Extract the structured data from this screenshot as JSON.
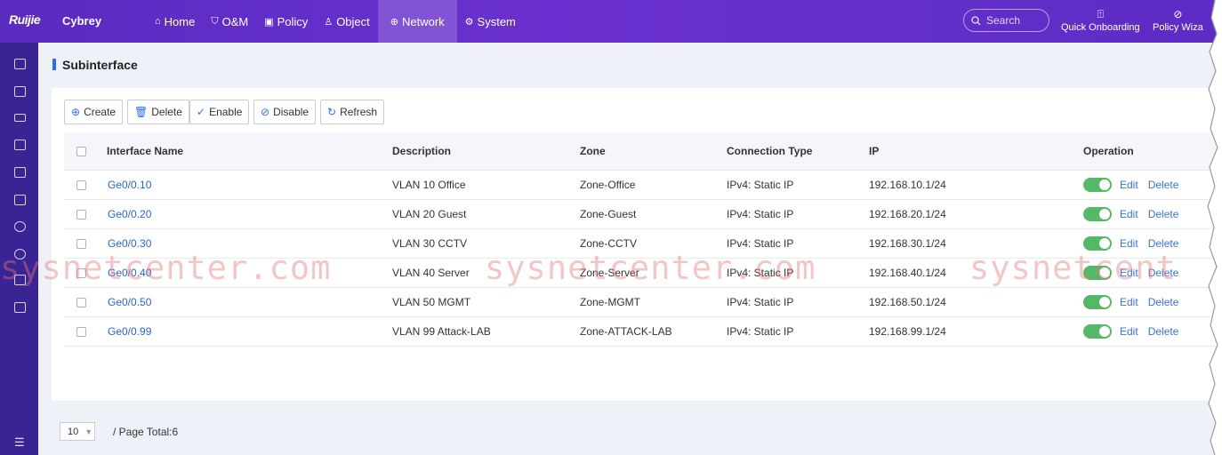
{
  "brand": {
    "logo": "Ruijie",
    "product": "Cybrey"
  },
  "nav": [
    {
      "label": "Home",
      "icon": "home-icon",
      "glyph": "⌂",
      "active": false
    },
    {
      "label": "O&M",
      "icon": "shield-icon",
      "glyph": "⛉",
      "active": false
    },
    {
      "label": "Policy",
      "icon": "policy-icon",
      "glyph": "▣",
      "active": false
    },
    {
      "label": "Object",
      "icon": "user-icon",
      "glyph": "♙",
      "active": false
    },
    {
      "label": "Network",
      "icon": "globe-icon",
      "glyph": "⊕",
      "active": true
    },
    {
      "label": "System",
      "icon": "gear-icon",
      "glyph": "⚙",
      "active": false
    }
  ],
  "search": {
    "placeholder": "Search"
  },
  "tools": {
    "quick_onboarding": "Quick Onboarding",
    "policy_wizard": "Policy Wiza"
  },
  "page": {
    "title": "Subinterface"
  },
  "toolbar": {
    "create": "Create",
    "delete": "Delete",
    "enable": "Enable",
    "disable": "Disable",
    "refresh": "Refresh"
  },
  "table": {
    "columns": {
      "name": "Interface Name",
      "description": "Description",
      "zone": "Zone",
      "connection_type": "Connection Type",
      "ip": "IP",
      "operation": "Operation"
    },
    "rows": [
      {
        "name": "Ge0/0.10",
        "description": "VLAN 10 Office",
        "zone": "Zone-Office",
        "connection_type": "IPv4: Static IP",
        "ip": "192.168.10.1/24",
        "enabled": true,
        "edit": "Edit",
        "delete": "Delete"
      },
      {
        "name": "Ge0/0.20",
        "description": "VLAN 20 Guest",
        "zone": "Zone-Guest",
        "connection_type": "IPv4: Static IP",
        "ip": "192.168.20.1/24",
        "enabled": true,
        "edit": "Edit",
        "delete": "Delete"
      },
      {
        "name": "Ge0/0.30",
        "description": "VLAN 30 CCTV",
        "zone": "Zone-CCTV",
        "connection_type": "IPv4: Static IP",
        "ip": "192.168.30.1/24",
        "enabled": true,
        "edit": "Edit",
        "delete": "Delete"
      },
      {
        "name": "Ge0/0.40",
        "description": "VLAN 40 Server",
        "zone": "Zone-Server",
        "connection_type": "IPv4: Static IP",
        "ip": "192.168.40.1/24",
        "enabled": true,
        "edit": "Edit",
        "delete": "Delete"
      },
      {
        "name": "Ge0/0.50",
        "description": "VLAN 50 MGMT",
        "zone": "Zone-MGMT",
        "connection_type": "IPv4: Static IP",
        "ip": "192.168.50.1/24",
        "enabled": true,
        "edit": "Edit",
        "delete": "Delete"
      },
      {
        "name": "Ge0/0.99",
        "description": "VLAN 99 Attack-LAB",
        "zone": "Zone-ATTACK-LAB",
        "connection_type": "IPv4: Static IP",
        "ip": "192.168.99.1/24",
        "enabled": true,
        "edit": "Edit",
        "delete": "Delete"
      }
    ]
  },
  "pagination": {
    "page_size": "10",
    "total_text": "/ Page Total:6"
  },
  "watermark": [
    "sysnetcenter.com",
    "sysnetcenter.com",
    "sysnetcent"
  ],
  "colors": {
    "topbar": "#5a2bc0",
    "sidebar": "#3a2393",
    "accent": "#2c6fe8",
    "toggle_on": "#54b867",
    "link": "#2c64c7"
  }
}
